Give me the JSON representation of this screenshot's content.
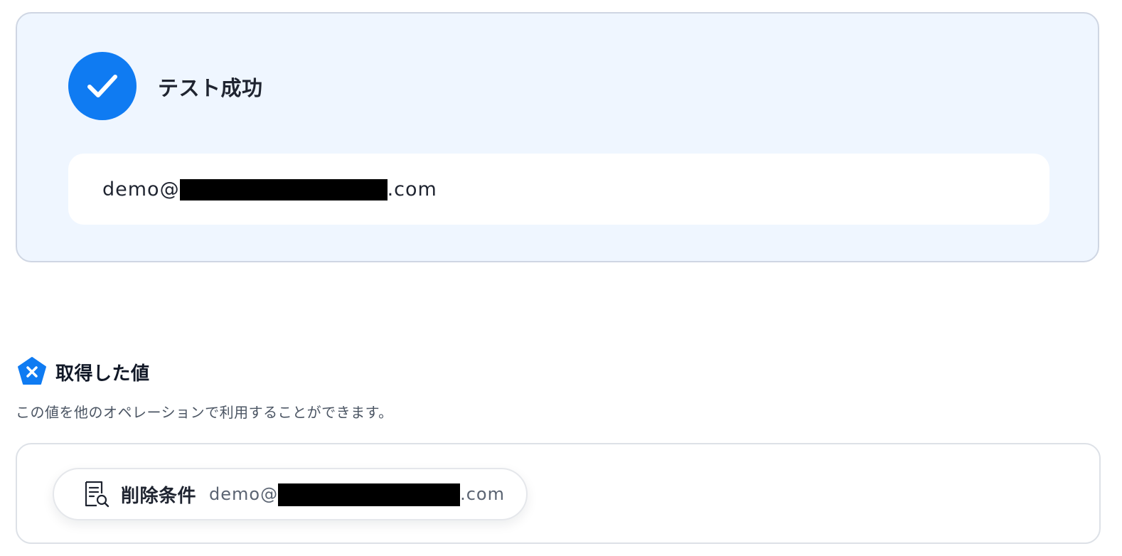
{
  "test_result": {
    "status_label": "テスト成功",
    "email_prefix": "demo@",
    "email_suffix": ".com"
  },
  "retrieved_values": {
    "title": "取得した値",
    "description": "この値を他のオペレーションで利用することができます。",
    "items": [
      {
        "label": "削除条件",
        "value_prefix": "demo@",
        "value_suffix": ".com"
      }
    ]
  },
  "colors": {
    "accent": "#0f7bf2",
    "panel_background": "#eff6ff",
    "panel_border": "#cfd6e3"
  },
  "icons": {
    "status": "check-icon",
    "section": "x-badge-icon",
    "item": "document-search-icon"
  }
}
